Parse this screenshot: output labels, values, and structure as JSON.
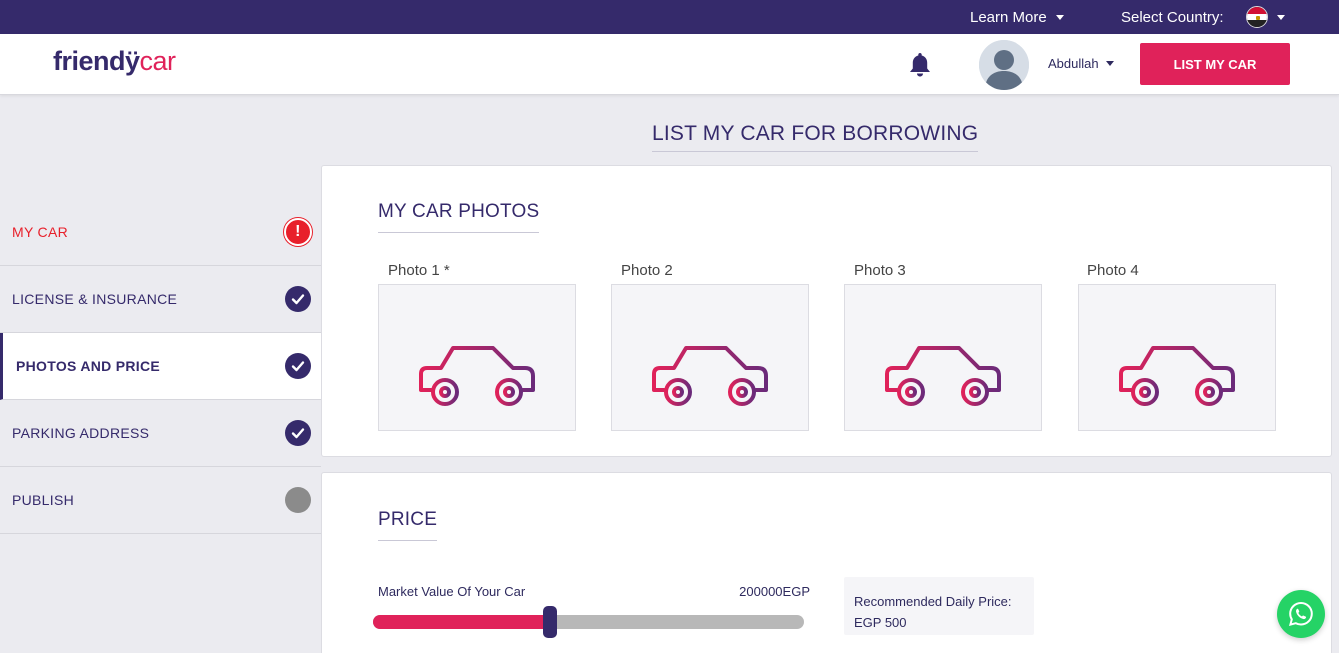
{
  "topbar": {
    "learn_more": "Learn More",
    "select_country": "Select Country:",
    "country_flag_icon": "egypt-flag-icon"
  },
  "header": {
    "logo_part1": "friendÿ",
    "logo_part2": "car",
    "bell_icon": "bell-icon",
    "username": "Abdullah",
    "list_button": "LIST MY CAR"
  },
  "page": {
    "title": "LIST MY CAR FOR BORROWING"
  },
  "sidebar": {
    "steps": [
      {
        "label": "MY CAR",
        "status": "error",
        "icon": "!"
      },
      {
        "label": "LICENSE & INSURANCE",
        "status": "complete"
      },
      {
        "label": "PHOTOS AND PRICE",
        "status": "complete",
        "active": true
      },
      {
        "label": "PARKING ADDRESS",
        "status": "complete"
      },
      {
        "label": "PUBLISH",
        "status": "pending"
      }
    ]
  },
  "photos": {
    "title": "MY CAR PHOTOS",
    "items": [
      {
        "label": "Photo 1 *"
      },
      {
        "label": "Photo 2"
      },
      {
        "label": "Photo 3"
      },
      {
        "label": "Photo 4"
      }
    ]
  },
  "price": {
    "title": "PRICE",
    "market_value_label": "Market Value Of Your Car",
    "market_value": "200000EGP",
    "slider_fraction": 0.41,
    "recommended_label": "Recommended Daily Price:",
    "recommended_value": "EGP 500"
  },
  "colors": {
    "brand_primary": "#352a6b",
    "brand_accent": "#e0225a",
    "error": "#e8202b",
    "whatsapp": "#25d366"
  }
}
